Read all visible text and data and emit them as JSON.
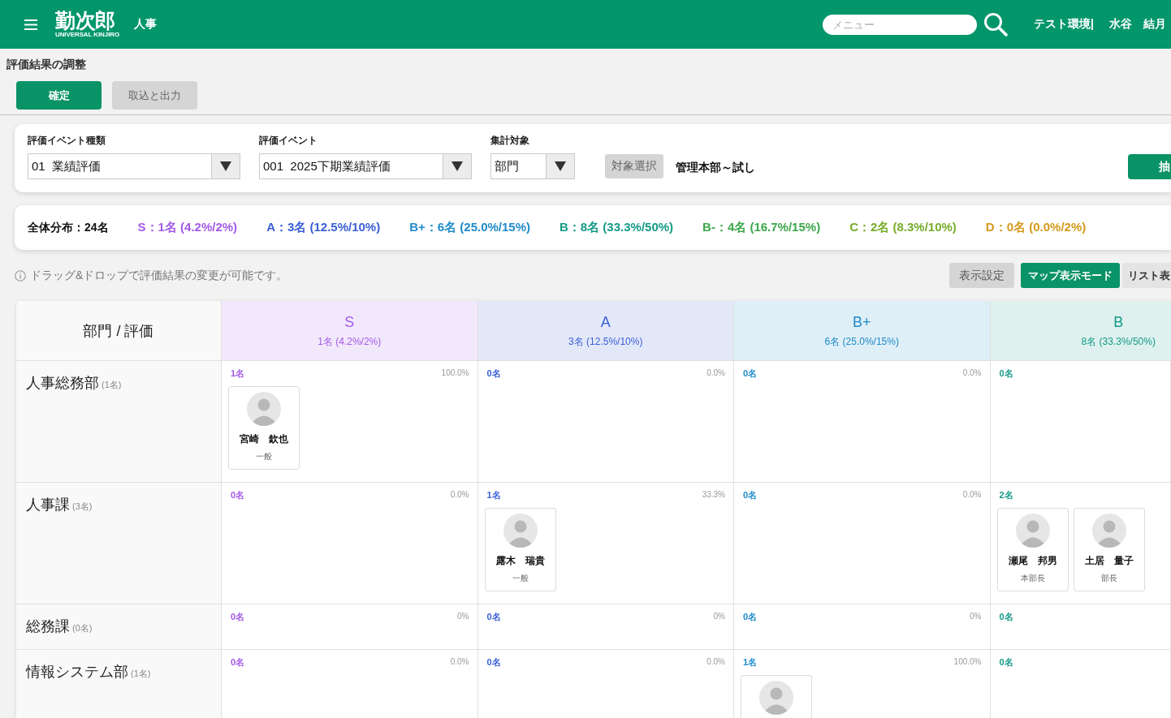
{
  "header": {
    "logo": {
      "name": "勤次郎",
      "subtitle": "UNIVERSAL KINJIRO"
    },
    "module": "人事",
    "search": {
      "placeholder": "メニュー"
    },
    "environment": "テスト環境|",
    "user": "水谷　結月"
  },
  "page": {
    "title": "評価結果の調整",
    "actions": [
      {
        "label": "確定",
        "kind": "primary"
      },
      {
        "label": "取込と出力",
        "kind": "secondary"
      }
    ]
  },
  "filters": {
    "fields": [
      {
        "label": "評価イベント種類",
        "value": "01  業績評価"
      },
      {
        "label": "評価イベント",
        "value": "001  2025下期業績評価"
      },
      {
        "label": "集計対象",
        "value": "部門"
      }
    ],
    "target_button": "対象選択",
    "target_value": "管理本部～試し",
    "action_button": "抽"
  },
  "distribution": {
    "total": "全体分布：24名",
    "items": [
      {
        "label": "S：1名 (4.2%/2%)",
        "color": "#a35ae6"
      },
      {
        "label": "A：3名 (12.5%/10%)",
        "color": "#3a5fd6"
      },
      {
        "label": "B+：6名 (25.0%/15%)",
        "color": "#1f8bc9"
      },
      {
        "label": "B：8名 (33.3%/50%)",
        "color": "#159a87"
      },
      {
        "label": "B-：4名 (16.7%/15%)",
        "color": "#3ca84c"
      },
      {
        "label": "C：2名 (8.3%/10%)",
        "color": "#76ad2a"
      },
      {
        "label": "D：0名 (0.0%/2%)",
        "color": "#d49a1c"
      }
    ]
  },
  "toolbar": {
    "hint": "ドラッグ&ドロップで評価結果の変更が可能です。",
    "settings_button": "表示設定",
    "view_modes": [
      {
        "label": "マップ表示モード",
        "selected": true
      },
      {
        "label": "リスト表",
        "selected": false
      }
    ]
  },
  "grid": {
    "corner": "部門 / 評価",
    "columns": [
      {
        "grade": "S",
        "summary": "1名 (4.2%/2%)",
        "color": "#a35ae6"
      },
      {
        "grade": "A",
        "summary": "3名 (12.5%/10%)",
        "color": "#3a5fd6"
      },
      {
        "grade": "B+",
        "summary": "6名 (25.0%/15%)",
        "color": "#1f8bc9"
      },
      {
        "grade": "B",
        "summary": "8名 (33.3%/50%)",
        "color": "#159a87"
      }
    ],
    "rows": [
      {
        "department": "人事総務部",
        "count": "(1名)",
        "cells": [
          {
            "count": "1名",
            "percent": "100.0%",
            "employees": [
              {
                "kind": "full",
                "name": "宮崎　欽也",
                "title": "一般"
              }
            ]
          },
          {
            "count": "0名",
            "percent": "0.0%"
          },
          {
            "count": "0名",
            "percent": "0.0%"
          },
          {
            "count": "0名"
          }
        ]
      },
      {
        "department": "人事課",
        "count": "(3名)",
        "cells": [
          {
            "count": "0名",
            "percent": "0.0%"
          },
          {
            "count": "1名",
            "percent": "33.3%",
            "employees": [
              {
                "kind": "full",
                "name": "露木　瑞貴",
                "title": "一般"
              }
            ]
          },
          {
            "count": "0名",
            "percent": "0.0%"
          },
          {
            "count": "2名",
            "employees": [
              {
                "kind": "full",
                "name": "瀬尾　邦男",
                "title": "本部長"
              },
              {
                "kind": "full",
                "name": "土居　量子",
                "title": "部長"
              }
            ]
          }
        ]
      },
      {
        "department": "総務課",
        "count": "(0名)",
        "cells": [
          {
            "count": "0名",
            "percent": "0%"
          },
          {
            "count": "0名",
            "percent": "0%"
          },
          {
            "count": "0名",
            "percent": "0%"
          },
          {
            "count": "0名"
          }
        ]
      },
      {
        "department": "情報システム部",
        "count": "(1名)",
        "cells": [
          {
            "count": "0名",
            "percent": "0.0%"
          },
          {
            "count": "0名",
            "percent": "0.0%"
          },
          {
            "count": "1名",
            "percent": "100.0%",
            "employees": [
              {
                "kind": "cut"
              }
            ]
          },
          {
            "count": "0名"
          }
        ]
      }
    ]
  }
}
